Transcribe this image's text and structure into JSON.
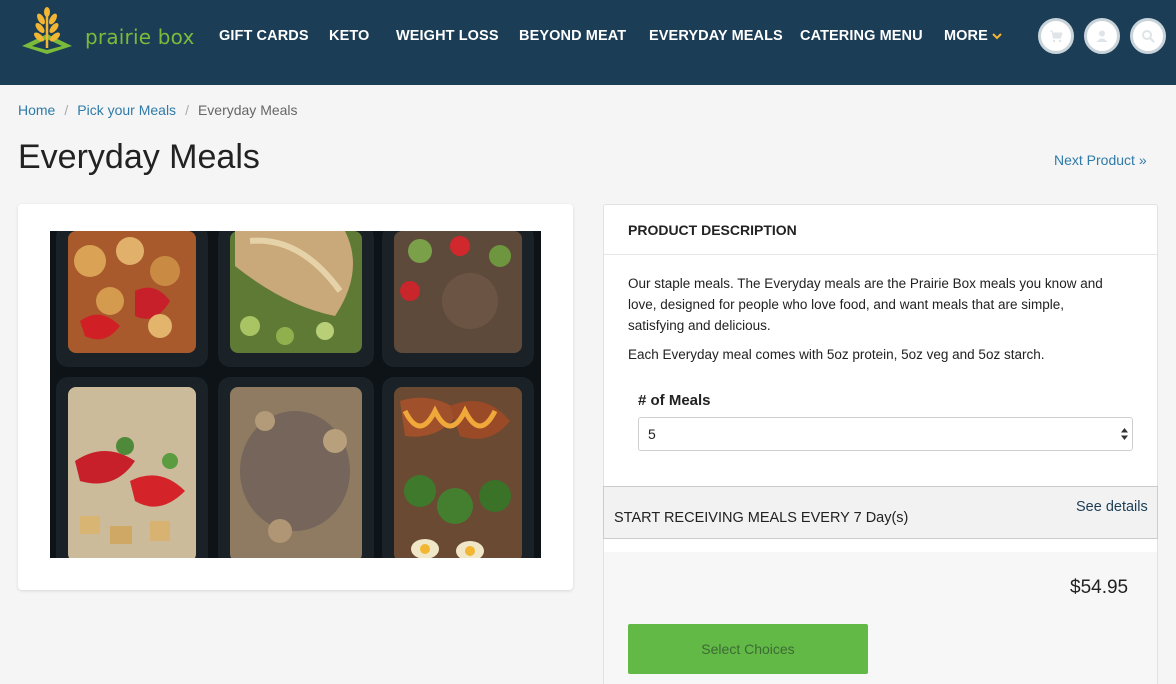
{
  "brand": {
    "name": "prairie box",
    "logo_icon": "wheat-icon",
    "accent": "#7bbb3a",
    "header_bg": "#1c3d56"
  },
  "nav": {
    "items": [
      "GIFT CARDS",
      "KETO",
      "WEIGHT LOSS",
      "BEYOND MEAT",
      "EVERYDAY MEALS",
      "CATERING MENU",
      "MORE"
    ],
    "more_icon": "chevron-down-icon",
    "icons": [
      "cart-icon",
      "user-icon",
      "search-icon"
    ]
  },
  "breadcrumb": {
    "home": "Home",
    "parent": "Pick your Meals",
    "current": "Everyday Meals",
    "separator": "/"
  },
  "page": {
    "title": "Everyday Meals",
    "next_product": "Next Product »"
  },
  "description": {
    "heading": "PRODUCT DESCRIPTION",
    "paragraph1": "Our staple meals. The Everyday meals are the Prairie Box meals you know and love, designed for people who love food, and want meals that are simple, satisfying and delicious.",
    "paragraph2": "Each Everyday meal comes with 5oz protein, 5oz veg and 5oz starch."
  },
  "options": {
    "meals_label": "# of Meals",
    "meals_value": "5"
  },
  "subscription": {
    "text": "START RECEIVING MEALS EVERY 7 Day(s)",
    "details_link": "See details"
  },
  "purchase": {
    "price": "$54.95",
    "button_label": "Select Choices",
    "button_color": "#62b946"
  }
}
